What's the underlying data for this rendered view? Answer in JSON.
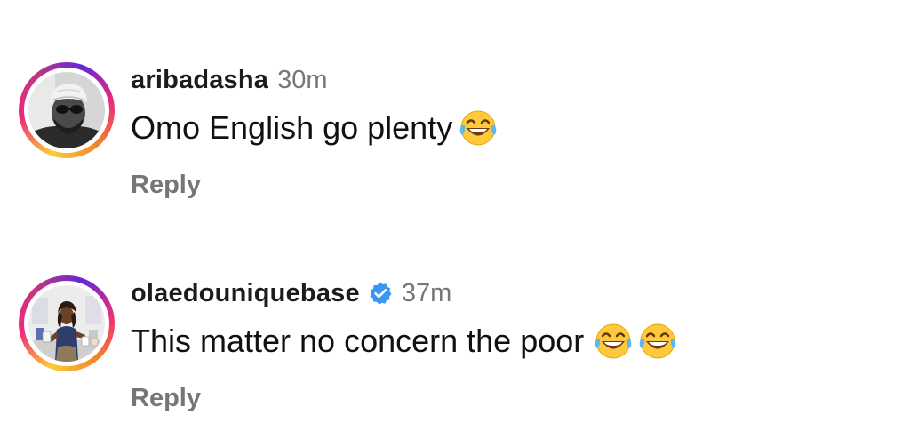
{
  "comments": [
    {
      "username": "aribadasha",
      "timestamp": "30m",
      "verified": false,
      "text": "Omo English go plenty",
      "emojis": [
        "face-with-tears-of-joy"
      ],
      "reply_label": "Reply",
      "avatar_icon": "man-with-cap-and-sunglasses"
    },
    {
      "username": "olaedouniquebase",
      "timestamp": "37m",
      "verified": true,
      "text": "This matter no concern the poor",
      "emojis": [
        "face-with-tears-of-joy",
        "face-with-tears-of-joy"
      ],
      "reply_label": "Reply",
      "avatar_icon": "woman-holding-products"
    }
  ],
  "colors": {
    "username": "#1c1c1c",
    "timestamp": "#777777",
    "reply": "#767676",
    "verified_badge": "#3897f0",
    "story_ring": [
      "#f9ce34",
      "#ee2a7b",
      "#6228d7"
    ]
  }
}
